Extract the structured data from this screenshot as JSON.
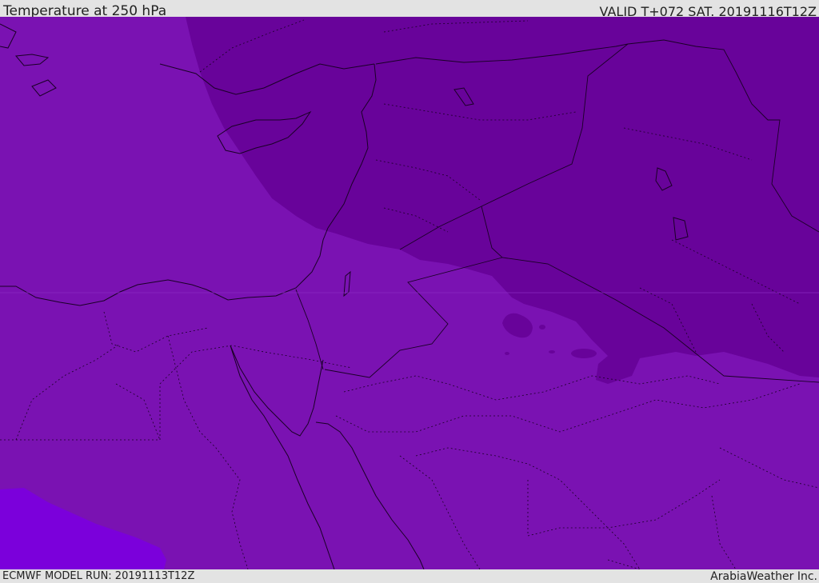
{
  "header": {
    "title": "Temperature at 250 hPa",
    "valid": "VALID T+072 SAT. 20191116T12Z"
  },
  "footer": {
    "model_run": "ECMWF MODEL RUN: 20191113T12Z",
    "credit": "ArabiaWeather Inc."
  },
  "colors": {
    "band_warmer": "#7a12b2",
    "band_colder": "#68039a",
    "band_warmest": "#7b00db",
    "frame": "#e3e3e3"
  }
}
